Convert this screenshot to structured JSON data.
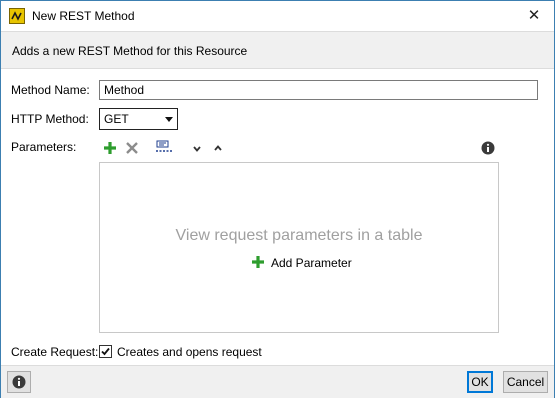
{
  "window": {
    "title": "New REST Method",
    "close_glyph": "✕",
    "app_icon": "rest-method-icon"
  },
  "header": {
    "description": "Adds a new REST Method for this Resource"
  },
  "form": {
    "method_name": {
      "label": "Method Name:",
      "value": "Method"
    },
    "http_method": {
      "label": "HTTP Method:",
      "selected": "GET"
    },
    "parameters": {
      "label": "Parameters:",
      "toolbar": [
        "add-icon",
        "delete-icon",
        "uri-parameter-icon",
        "move-down-icon",
        "move-up-icon",
        "info-icon"
      ],
      "empty_message": "View request parameters in a table",
      "add_label": "Add Parameter"
    },
    "create_request": {
      "label": "Create Request:",
      "checked": true,
      "text": "Creates and opens request"
    }
  },
  "footer": {
    "help_icon": "info-icon",
    "ok_label": "OK",
    "cancel_label": "Cancel"
  },
  "colors": {
    "accent": "#0078d7",
    "add_green": "#2e9d2e",
    "border": "#3c7fb1"
  }
}
